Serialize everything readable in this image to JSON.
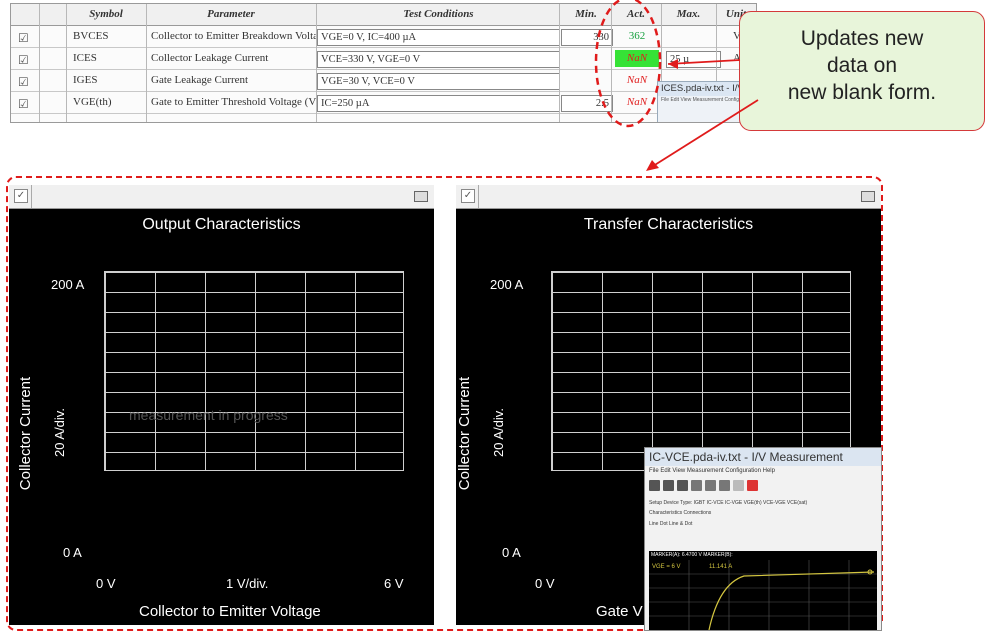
{
  "table": {
    "headers": [
      "Symbol",
      "Parameter",
      "Test Conditions",
      "Min.",
      "Act.",
      "Max.",
      "Unit"
    ],
    "rows": [
      {
        "symbol": "BVCES",
        "parameter": "Collector to Emitter Breakdown Volta",
        "conditions": "VGE=0 V, IC=400 µA",
        "min": "330",
        "act": "362",
        "max": "",
        "unit": "V"
      },
      {
        "symbol": "ICES",
        "parameter": "Collector Leakage Current",
        "conditions": "VCE=330 V, VGE=0 V",
        "min": "",
        "act": "NaN",
        "max": "25 µ",
        "unit": "A"
      },
      {
        "symbol": "IGES",
        "parameter": "Gate Leakage Current",
        "conditions": "VGE=30 V, VCE=0 V",
        "min": "",
        "act": "NaN",
        "max": "",
        "unit": ""
      },
      {
        "symbol": "VGE(th)",
        "parameter": "Gate to Emitter Threshold Voltage (V",
        "conditions": "IC=250 µA",
        "min": "2.5",
        "act": "NaN",
        "max": "",
        "unit": ""
      }
    ],
    "mini_window": {
      "title": "ICES.pda-iv.txt - I/V",
      "menu": "File  Edit  View  Measurement  Configu"
    }
  },
  "callout": {
    "lines": [
      "Updates new",
      "data on",
      "new blank form."
    ]
  },
  "panels": {
    "left": {
      "title": "Output Characteristics",
      "y_top": "200  A",
      "y_mid": "20  A/div.",
      "y_bottom": "0  A",
      "x_left": "0  V",
      "x_mid": "1  V/div.",
      "x_right": "6  V",
      "ylabel": "Collector Current",
      "xlabel": "Collector to Emitter Voltage",
      "watermark": "measurement in progress"
    },
    "right": {
      "title": "Transfer Characteristics",
      "y_top": "200  A",
      "y_mid": "20  A/div.",
      "y_bottom": "0  A",
      "x_left": "0  V",
      "ylabel": "Collector Current",
      "xlabel_partial": "Gate V"
    }
  },
  "popup": {
    "title": "IC-VCE.pda-iv.txt - I/V Measurement",
    "menu": "File  Edit  View  Measurement  Configuration  Help",
    "setup": "Setup   Device Type: IGBT   IC-VCE  IC-VGE  VGE(th)  VCE-VGE  VCE(sat)",
    "tabs": "Characteristics     Connections",
    "opts": "Line   Dot   Line & Dot",
    "marker_info": "MARKER(A): 6.4700 V     MARKER(B):",
    "trace_label": "VGE = 6 V",
    "trace_value": "11.141 A"
  },
  "colors": {
    "accent_red": "#e01b1b",
    "pass_green": "#18a040",
    "fail_highlight": "#36e236",
    "callout_bg": "#e8f5da"
  }
}
